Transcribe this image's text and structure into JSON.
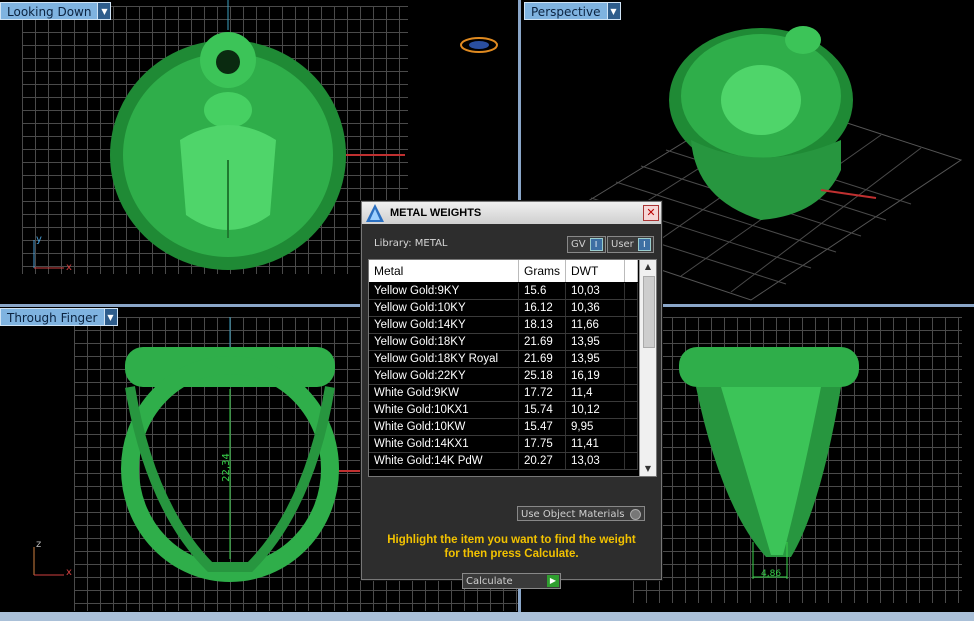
{
  "viewports": {
    "top_left": {
      "label": "Looking Down",
      "axis_y": "y",
      "axis_x": "x"
    },
    "top_right": {
      "label": "Perspective"
    },
    "bottom_left": {
      "label": "Through Finger",
      "axis_z": "z",
      "axis_x": "x",
      "dimension": "22,34"
    },
    "bottom_right": {
      "dimension": "4,86"
    }
  },
  "dialog": {
    "title": "METAL WEIGHTS",
    "close_icon": "close-icon",
    "library_label": "Library: METAL",
    "gv_label": "GV",
    "user_label": "User",
    "columns": [
      "Metal",
      "Grams",
      "DWT"
    ],
    "rows": [
      {
        "metal": "Yellow Gold:9KY",
        "grams": "15.6",
        "dwt": "10,03"
      },
      {
        "metal": "Yellow Gold:10KY",
        "grams": "16.12",
        "dwt": "10,36"
      },
      {
        "metal": "Yellow Gold:14KY",
        "grams": "18.13",
        "dwt": "11,66"
      },
      {
        "metal": "Yellow Gold:18KY",
        "grams": "21.69",
        "dwt": "13,95"
      },
      {
        "metal": "Yellow Gold:18KY Royal",
        "grams": "21.69",
        "dwt": "13,95"
      },
      {
        "metal": "Yellow Gold:22KY",
        "grams": "25.18",
        "dwt": "16,19"
      },
      {
        "metal": "White Gold:9KW",
        "grams": "17.72",
        "dwt": "11,4"
      },
      {
        "metal": "White Gold:10KX1",
        "grams": "15.74",
        "dwt": "10,12"
      },
      {
        "metal": "White Gold:10KW",
        "grams": "15.47",
        "dwt": "9,95"
      },
      {
        "metal": "White Gold:14KX1",
        "grams": "17.75",
        "dwt": "11,41"
      },
      {
        "metal": "White Gold:14K PdW",
        "grams": "20.27",
        "dwt": "13,03"
      }
    ],
    "use_object_materials": "Use Object Materials",
    "hint_line1": "Highlight the item you want to find the weight",
    "hint_line2": "for then press Calculate.",
    "calculate_label": "Calculate"
  },
  "colors": {
    "ring_green": "#2fae4a",
    "tab_blue": "#7fb3e0",
    "hint_yellow": "#f2c200"
  }
}
